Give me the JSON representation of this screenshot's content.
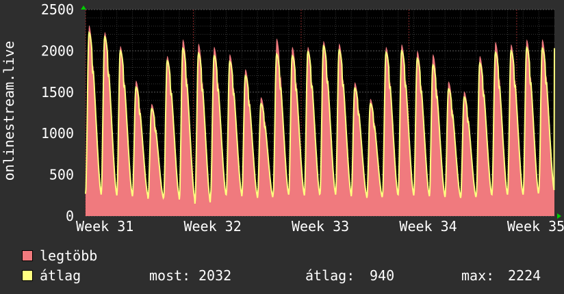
{
  "chart_data": {
    "type": "line",
    "title": "",
    "ylabel": "onlinestream.live",
    "xlabel": "",
    "ylim": [
      0,
      2500
    ],
    "yticks": [
      0,
      500,
      1000,
      1500,
      2000,
      2500
    ],
    "x_tick_labels": [
      "Week 31",
      "Week 32",
      "Week 33",
      "Week 34",
      "Week 35"
    ],
    "grid": true,
    "legend_placement": "bottom-left",
    "days_shown": 30,
    "series": [
      {
        "name": "legtöbb",
        "color": "#f07a7e",
        "style": "area",
        "daily_peak": [
          2310,
          2230,
          2060,
          1640,
          1360,
          1940,
          2140,
          2090,
          2050,
          1960,
          1780,
          1440,
          2150,
          2050,
          2050,
          2120,
          2090,
          1620,
          1420,
          2050,
          2080,
          2000,
          1960,
          1630,
          1510,
          1940,
          2110,
          2080,
          2140,
          2140
        ]
      },
      {
        "name": "átlag",
        "color": "#ffff80",
        "style": "line",
        "daily_peak": [
          2220,
          2170,
          2000,
          1560,
          1300,
          1880,
          2030,
          1970,
          1940,
          1870,
          1700,
          1360,
          1960,
          1940,
          1990,
          2060,
          2010,
          1550,
          1360,
          1980,
          2000,
          1910,
          1830,
          1540,
          1440,
          1850,
          1980,
          2000,
          2040,
          2032
        ]
      }
    ],
    "daily_trough": [
      270,
      260,
      250,
      240,
      210,
      230,
      200,
      150,
      250,
      260,
      240,
      220,
      260,
      260,
      250,
      270,
      260,
      240,
      220,
      250,
      260,
      250,
      240,
      230,
      220,
      250,
      260,
      260,
      260,
      300
    ],
    "legend": {
      "max_label": "legtöbb",
      "avg_label": "átlag",
      "stats": [
        {
          "label": "most:",
          "value": "2032"
        },
        {
          "label": "átlag:",
          "value": "940"
        },
        {
          "label": "max:",
          "value": "2224"
        }
      ]
    },
    "colors": {
      "background": "#2e2e2e",
      "plot_background": "#000000",
      "grid": "#5a5a5a",
      "axis_text": "#ffffff",
      "axis_arrow": "#00cc00"
    }
  }
}
